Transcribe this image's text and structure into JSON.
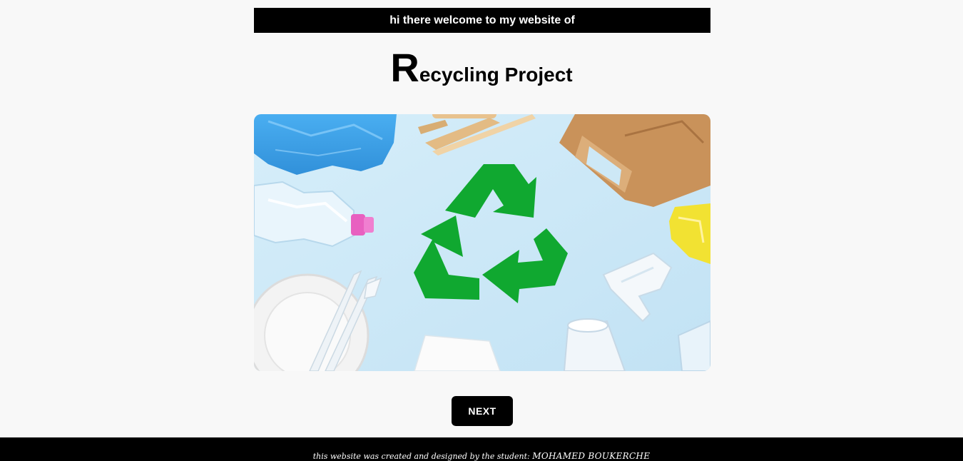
{
  "banner": {
    "text": "hi there welcome to my website of"
  },
  "title": {
    "initial": "R",
    "rest": "ecycling Project"
  },
  "hero": {
    "description": "recycling-symbol-with-plastic-and-paper-waste",
    "icon": "recycle-icon",
    "colors": {
      "background": "#cfe9f7",
      "recycle_green": "#10a830"
    }
  },
  "navigation": {
    "next_label": "NEXT"
  },
  "footer": {
    "credit_text": "this website was created and designed by the student: ",
    "author": "MOHAMED BOUKERCHE"
  },
  "colors": {
    "page_background": "#f8f8f8",
    "banner_background": "#000000",
    "banner_text": "#ffffff",
    "button_background": "#000000",
    "footer_background": "#000000"
  }
}
